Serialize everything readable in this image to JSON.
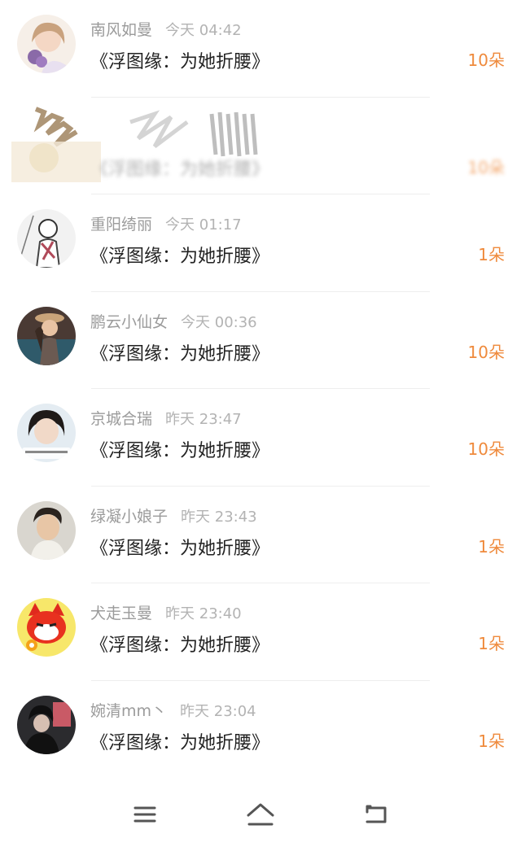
{
  "messages": [
    {
      "name": "南风如曼",
      "time": "今天 04:42",
      "title": "《浮图缘：为她折腰》",
      "amount": "10朵"
    },
    {
      "name": "",
      "time": "",
      "title": "《浮图缘：为她折腰》",
      "amount": "10朵"
    },
    {
      "name": "重阳绮丽",
      "time": "今天 01:17",
      "title": "《浮图缘：为她折腰》",
      "amount": "1朵"
    },
    {
      "name": "鹏云小仙女",
      "time": "今天 00:36",
      "title": "《浮图缘：为她折腰》",
      "amount": "10朵"
    },
    {
      "name": "京城合瑞",
      "time": "昨天 23:47",
      "title": "《浮图缘：为她折腰》",
      "amount": "10朵"
    },
    {
      "name": "绿凝小娘子",
      "time": "昨天 23:43",
      "title": "《浮图缘：为她折腰》",
      "amount": "1朵"
    },
    {
      "name": "犬走玉曼",
      "time": "昨天 23:40",
      "title": "《浮图缘：为她折腰》",
      "amount": "1朵"
    },
    {
      "name": "婉清mm丶",
      "time": "昨天 23:04",
      "title": "《浮图缘：为她折腰》",
      "amount": "1朵"
    }
  ],
  "colors": {
    "accent": "#ef8a3c",
    "meta": "#9b9b9b",
    "title": "#222222"
  },
  "navbar": {
    "icons": [
      "menu-icon",
      "home-icon",
      "back-icon"
    ]
  }
}
